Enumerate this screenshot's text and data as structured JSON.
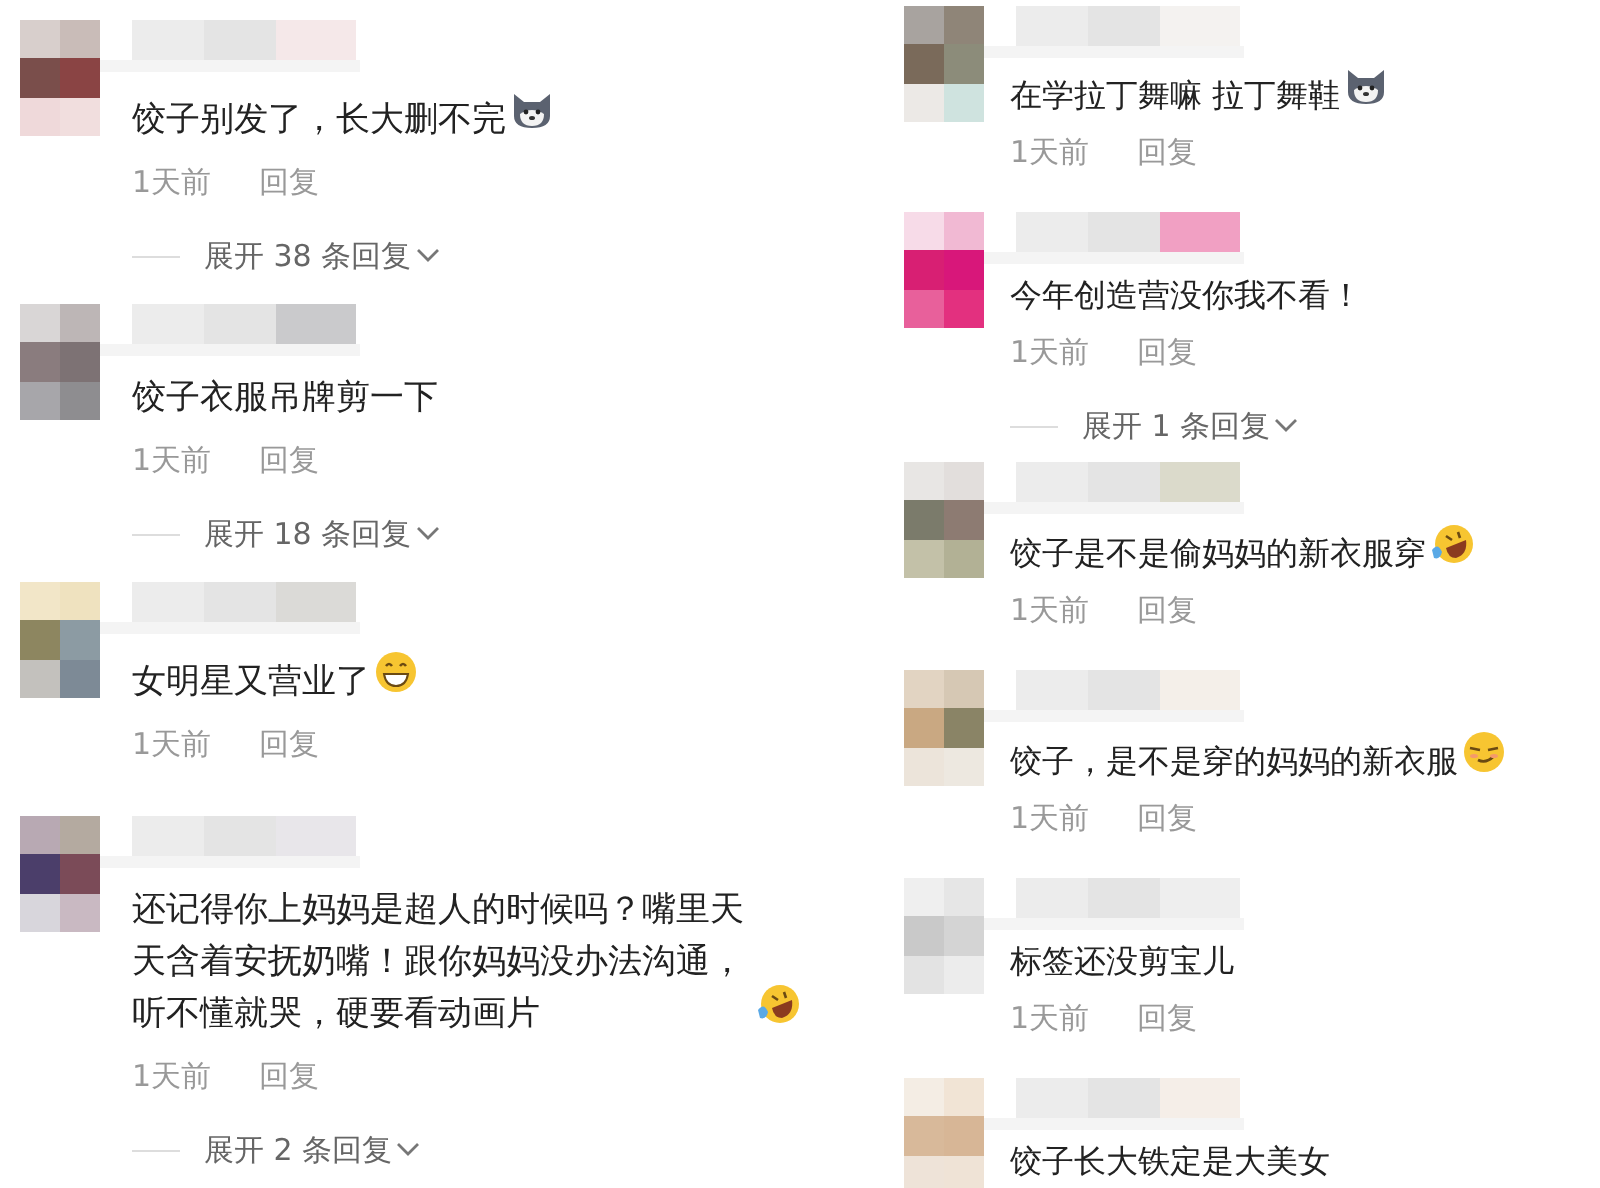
{
  "left_column": [
    {
      "text": "饺子别发了，长大删不完",
      "kind": "dog",
      "time": "1天前",
      "reply": "回复",
      "expand": "展开 38 条回复"
    },
    {
      "text": "饺子衣服吊牌剪一下",
      "kind": "plain",
      "time": "1天前",
      "reply": "回复",
      "expand": "展开 18 条回复"
    },
    {
      "text": "女明星又营业了",
      "kind": "grin",
      "time": "1天前",
      "reply": "回复"
    },
    {
      "text": "还记得你上妈妈是超人的时候吗？嘴里天天含着安抚奶嘴！跟你妈妈没办法沟通，听不懂就哭，硬要看动画片",
      "kind": "laughing",
      "time": "1天前",
      "reply": "回复",
      "expand": "展开 2 条回复"
    }
  ],
  "right_column": [
    {
      "text": "在学拉丁舞嘛 拉丁舞鞋",
      "kind": "dog",
      "time": "1天前",
      "reply": "回复"
    },
    {
      "text": "今年创造营没你我不看！",
      "kind": "plain",
      "time": "1天前",
      "reply": "回复",
      "expand": "展开 1 条回复"
    },
    {
      "text": "饺子是不是偷妈妈的新衣服穿",
      "kind": "laughing",
      "time": "1天前",
      "reply": "回复"
    },
    {
      "text": "饺子，是不是穿的妈妈的新衣服",
      "kind": "smirk",
      "time": "1天前",
      "reply": "回复"
    },
    {
      "text": "标签还没剪宝儿",
      "kind": "plain",
      "time": "1天前",
      "reply": "回复"
    },
    {
      "text": "饺子长大铁定是大美女",
      "kind": "plain"
    }
  ]
}
